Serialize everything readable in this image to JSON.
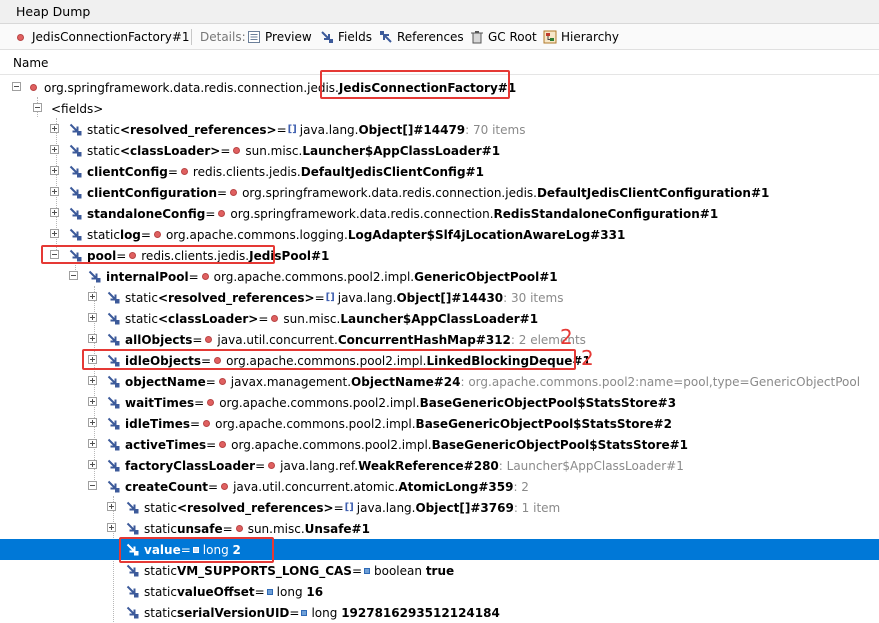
{
  "window": {
    "title": "Heap Dump"
  },
  "toolbar": {
    "object_label": "JedisConnectionFactory#1",
    "details_label": "Details:",
    "buttons": [
      "Preview",
      "Fields",
      "References",
      "GC Root",
      "Hierarchy"
    ]
  },
  "columns": {
    "name": "Name"
  },
  "tree": {
    "root": {
      "pkg": "org.springframework.data.redis.connection.jedis.",
      "cls": "JedisConnectionFactory#1"
    },
    "fields_node": "<fields>",
    "r2": {
      "pre": "static ",
      "name": "<resolved_references>",
      "pkg": "java.lang.",
      "cls": "Object[]#14479",
      "info": " : 70 items"
    },
    "r3": {
      "pre": "static ",
      "name": "<classLoader>",
      "pkg": "sun.misc.",
      "cls": "Launcher$AppClassLoader#1"
    },
    "r4": {
      "name": "clientConfig",
      "pkg": "redis.clients.jedis.",
      "cls": "DefaultJedisClientConfig#1"
    },
    "r5": {
      "name": "clientConfiguration",
      "pkg": "org.springframework.data.redis.connection.jedis.",
      "cls": "DefaultJedisClientConfiguration#1"
    },
    "r6": {
      "name": "standaloneConfig",
      "pkg": "org.springframework.data.redis.connection.",
      "cls": "RedisStandaloneConfiguration#1"
    },
    "r7": {
      "pre": "static ",
      "name": "log",
      "pkg": "org.apache.commons.logging.",
      "cls": "LogAdapter$Slf4jLocationAwareLog#331"
    },
    "r8": {
      "name": "pool",
      "pkg": "redis.clients.jedis.",
      "cls": "JedisPool#1"
    },
    "r9": {
      "name": "internalPool",
      "pkg": "org.apache.commons.pool2.impl.",
      "cls": "GenericObjectPool#1"
    },
    "r10": {
      "pre": "static ",
      "name": "<resolved_references>",
      "pkg": "java.lang.",
      "cls": "Object[]#14430",
      "info": " : 30 items"
    },
    "r11": {
      "pre": "static ",
      "name": "<classLoader>",
      "pkg": "sun.misc.",
      "cls": "Launcher$AppClassLoader#1"
    },
    "r12": {
      "name": "allObjects",
      "pkg": "java.util.concurrent.",
      "cls": "ConcurrentHashMap#312",
      "info": " : 2 elements"
    },
    "r13": {
      "name": "idleObjects",
      "pkg": "org.apache.commons.pool2.impl.",
      "cls": "LinkedBlockingDeque#1"
    },
    "r14": {
      "name": "objectName",
      "pkg": "javax.management.",
      "cls": "ObjectName#24",
      "info": " : org.apache.commons.pool2:name=pool,type=GenericObjectPool"
    },
    "r15": {
      "name": "waitTimes",
      "pkg": "org.apache.commons.pool2.impl.",
      "cls": "BaseGenericObjectPool$StatsStore#3"
    },
    "r16": {
      "name": "idleTimes",
      "pkg": "org.apache.commons.pool2.impl.",
      "cls": "BaseGenericObjectPool$StatsStore#2"
    },
    "r17": {
      "name": "activeTimes",
      "pkg": "org.apache.commons.pool2.impl.",
      "cls": "BaseGenericObjectPool$StatsStore#1"
    },
    "r18": {
      "name": "factoryClassLoader",
      "pkg": "java.lang.ref.",
      "cls": "WeakReference#280",
      "info": " : Launcher$AppClassLoader#1"
    },
    "r19": {
      "name": "createCount",
      "pkg": "java.util.concurrent.atomic.",
      "cls": "AtomicLong#359",
      "info": " : 2"
    },
    "r20": {
      "pre": "static ",
      "name": "<resolved_references>",
      "pkg": "java.lang.",
      "cls": "Object[]#3769",
      "info": " : 1 item"
    },
    "r21": {
      "pre": "static ",
      "name": "unsafe",
      "pkg": "sun.misc.",
      "cls": "Unsafe#1"
    },
    "r22": {
      "name": "value",
      "type": "long",
      "val": "2"
    },
    "r23": {
      "pre": "static ",
      "name": "VM_SUPPORTS_LONG_CAS",
      "type": "boolean",
      "val": "true"
    },
    "r24": {
      "pre": "static ",
      "name": "valueOffset",
      "type": "long",
      "val": "16"
    },
    "r25": {
      "pre": "static ",
      "name": "serialVersionUID",
      "type": "long",
      "val": "1927816293512124184"
    },
    "eq": " = "
  },
  "annotations": {
    "n1": "2",
    "n2": "2"
  },
  "colors": {
    "selection": "#0078d7",
    "highlight_box": "#e53935",
    "object_dot": "#e06060"
  }
}
